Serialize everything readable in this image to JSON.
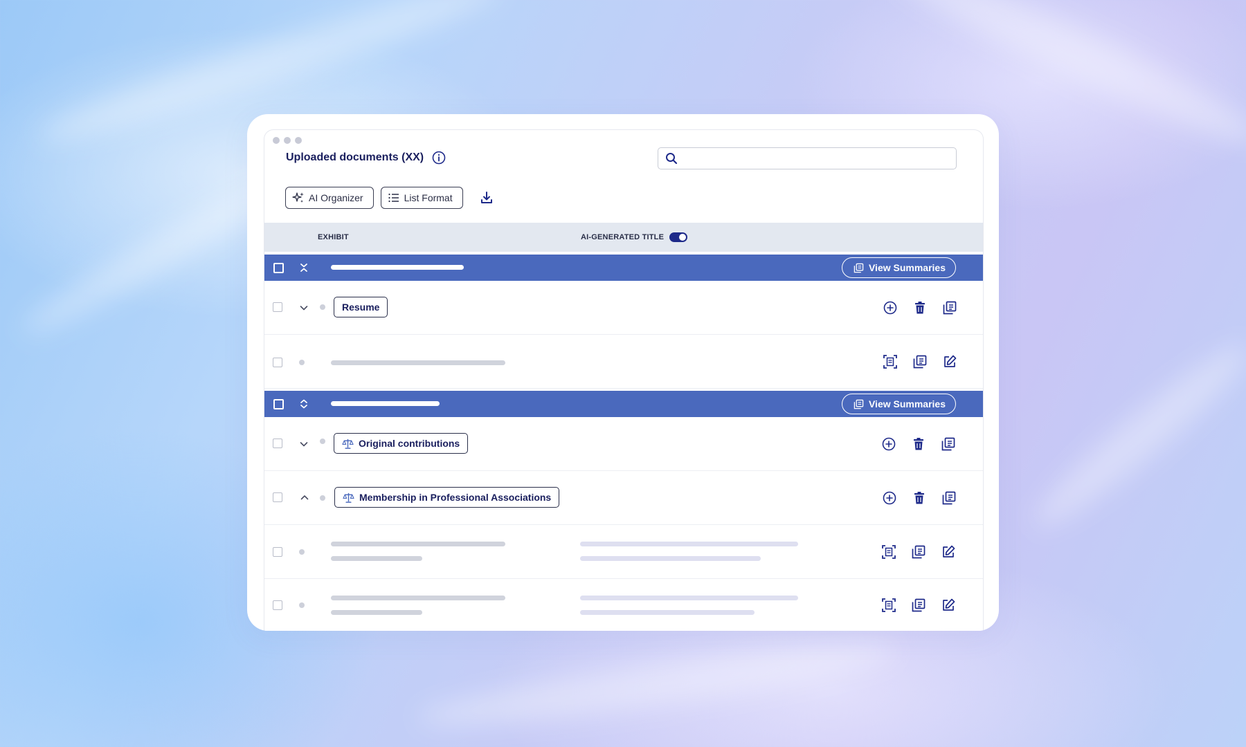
{
  "header": {
    "title": "Uploaded documents (XX)"
  },
  "search": {
    "placeholder": ""
  },
  "toolbar": {
    "ai_organizer_label": "AI Organizer",
    "list_format_label": "List Format"
  },
  "table": {
    "col_exhibit": "EXHIBIT",
    "col_ai_title": "AI-GENERATED TITLE",
    "ai_title_toggle_on": true
  },
  "groups": [
    {
      "view_summaries_label": "View Summaries",
      "expanded": true
    },
    {
      "view_summaries_label": "View Summaries",
      "expanded": false
    }
  ],
  "items": {
    "resume": "Resume",
    "original_contributions": "Original contributions",
    "membership": "Membership in Professional Associations"
  },
  "icons": {
    "info": "info-icon",
    "search": "search-icon",
    "ai_organizer": "sparkles-icon",
    "list_format": "list-icon",
    "download": "download-icon",
    "add": "plus-circle-icon",
    "delete": "trash-icon",
    "summaries": "documents-icon",
    "scan": "scan-icon",
    "edit": "edit-icon",
    "criteria": "scale-icon"
  },
  "colors": {
    "accent": "#4a69bd",
    "primary_text": "#1a1f5e",
    "icon": "#1e2a8a"
  }
}
